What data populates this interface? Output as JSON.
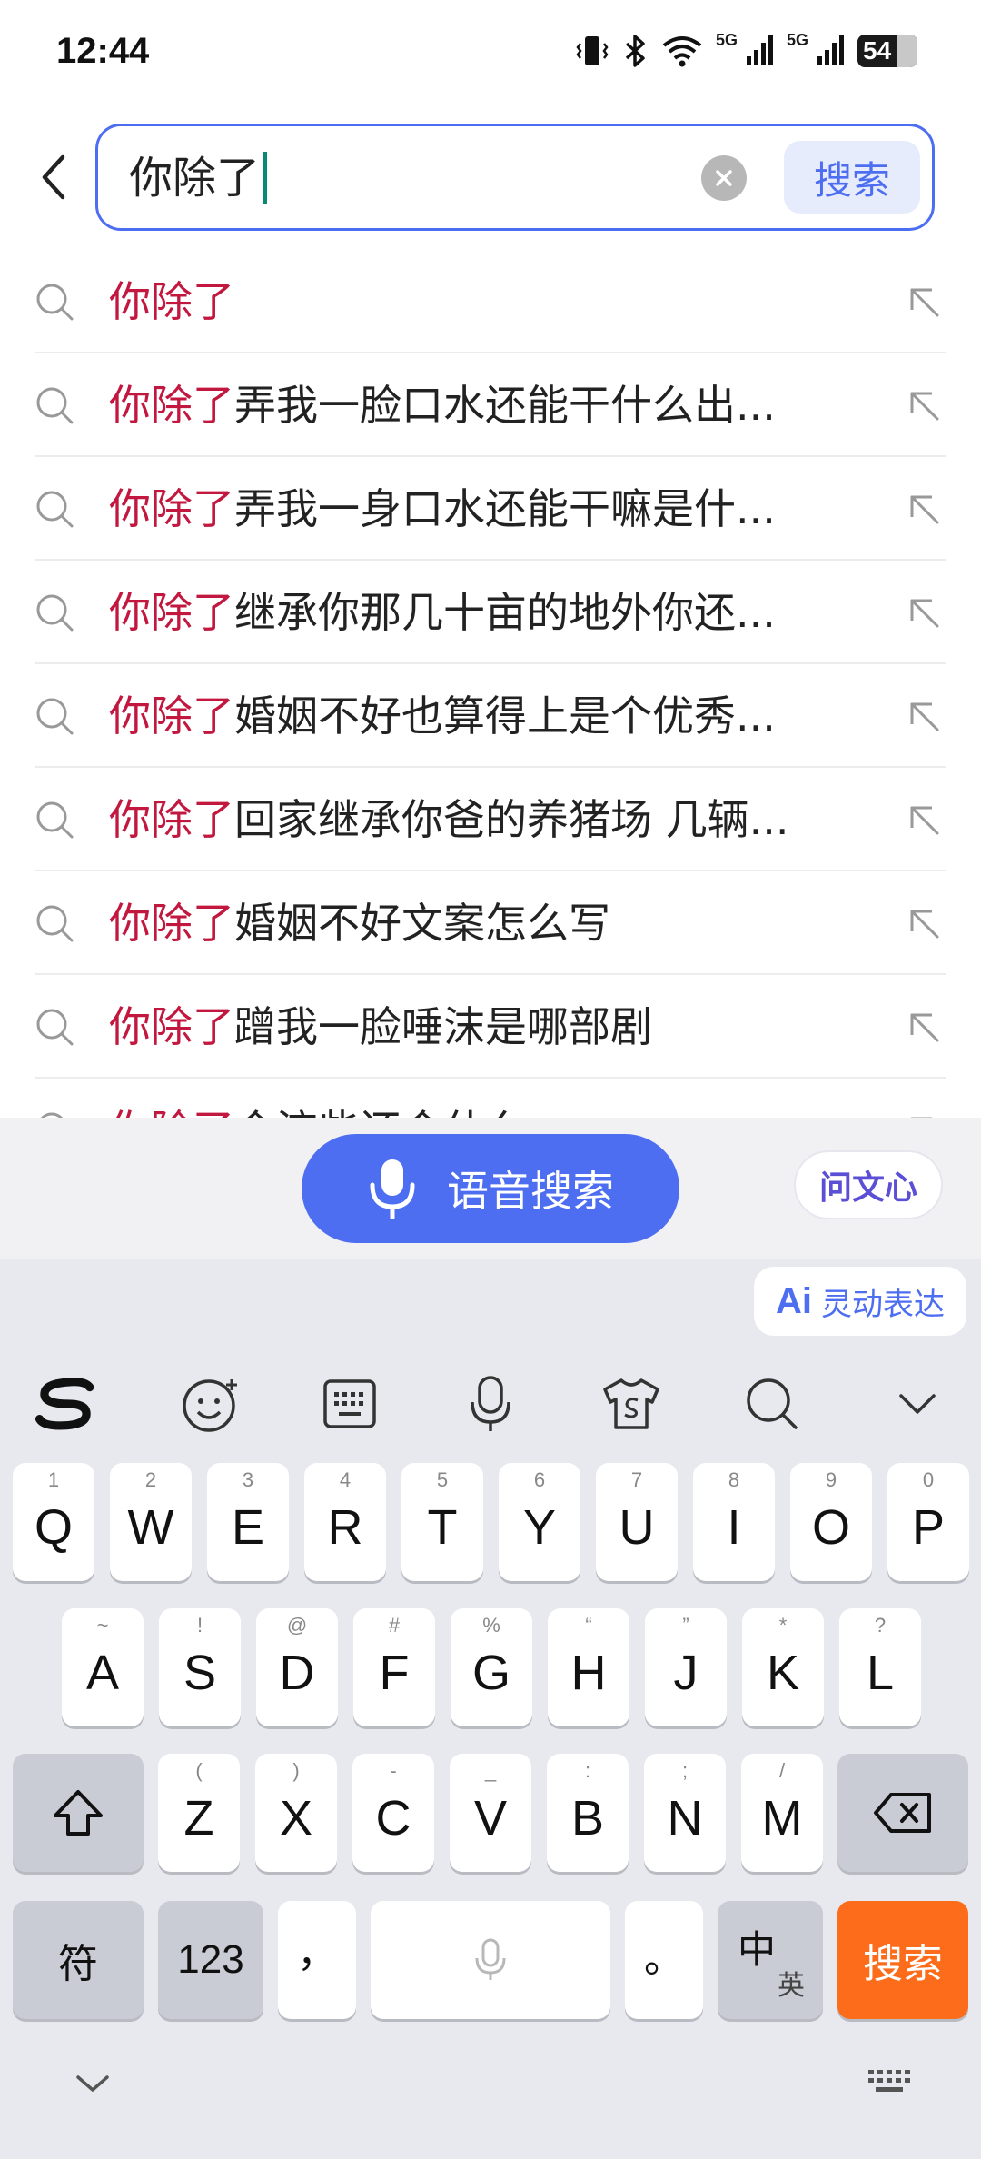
{
  "status_bar": {
    "time": "12:44",
    "net1": "5G",
    "net2": "5G",
    "battery": "54",
    "icons": [
      "vibrate-icon",
      "bluetooth-icon",
      "wifi-icon",
      "signal-icon",
      "signal-icon",
      "battery-icon"
    ]
  },
  "search": {
    "query": "你除了",
    "button_label": "搜索",
    "accent_color": "#4e6ef2"
  },
  "suggestions": [
    {
      "highlight": "你除了",
      "rest": ""
    },
    {
      "highlight": "你除了",
      "rest": "弄我一脸口水还能干什么出..."
    },
    {
      "highlight": "你除了",
      "rest": "弄我一身口水还能干嘛是什..."
    },
    {
      "highlight": "你除了",
      "rest": "继承你那几十亩的地外你还..."
    },
    {
      "highlight": "你除了",
      "rest": "婚姻不好也算得上是个优秀..."
    },
    {
      "highlight": "你除了",
      "rest": "回家继承你爸的养猪场 几辆..."
    },
    {
      "highlight": "你除了",
      "rest": "婚姻不好文案怎么写"
    },
    {
      "highlight": "你除了",
      "rest": "蹭我一脸唾沫是哪部剧"
    },
    {
      "highlight": "你除了",
      "rest": "会流些还会什么"
    }
  ],
  "voice_bar": {
    "voice_label": "语音搜索",
    "wenxin_label": "问文心"
  },
  "keyboard": {
    "lingdong_ai": "Ai",
    "lingdong_label": "灵动表达",
    "toolbar_icons": [
      "sogou-logo-icon",
      "emoji-icon",
      "keyboard-layout-icon",
      "microphone-icon",
      "skin-shirt-icon",
      "search-icon",
      "collapse-chevron-icon"
    ],
    "row1": [
      {
        "main": "Q",
        "sup": "1"
      },
      {
        "main": "W",
        "sup": "2"
      },
      {
        "main": "E",
        "sup": "3"
      },
      {
        "main": "R",
        "sup": "4"
      },
      {
        "main": "T",
        "sup": "5"
      },
      {
        "main": "Y",
        "sup": "6"
      },
      {
        "main": "U",
        "sup": "7"
      },
      {
        "main": "I",
        "sup": "8"
      },
      {
        "main": "O",
        "sup": "9"
      },
      {
        "main": "P",
        "sup": "0"
      }
    ],
    "row2": [
      {
        "main": "A",
        "sup": "~"
      },
      {
        "main": "S",
        "sup": "!"
      },
      {
        "main": "D",
        "sup": "@"
      },
      {
        "main": "F",
        "sup": "#"
      },
      {
        "main": "G",
        "sup": "%"
      },
      {
        "main": "H",
        "sup": "“"
      },
      {
        "main": "J",
        "sup": "”"
      },
      {
        "main": "K",
        "sup": "*"
      },
      {
        "main": "L",
        "sup": "?"
      }
    ],
    "row3": [
      {
        "main": "Z",
        "sup": "("
      },
      {
        "main": "X",
        "sup": ")"
      },
      {
        "main": "C",
        "sup": "-"
      },
      {
        "main": "V",
        "sup": "_"
      },
      {
        "main": "B",
        "sup": ":"
      },
      {
        "main": "N",
        "sup": ";"
      },
      {
        "main": "M",
        "sup": "/"
      }
    ],
    "symbols_label": "符",
    "numbers_label": "123",
    "comma_label": "，",
    "period_label": "。",
    "lang_primary": "中",
    "lang_secondary": "英",
    "enter_label": "搜索",
    "enter_color": "#fc6c1b"
  }
}
